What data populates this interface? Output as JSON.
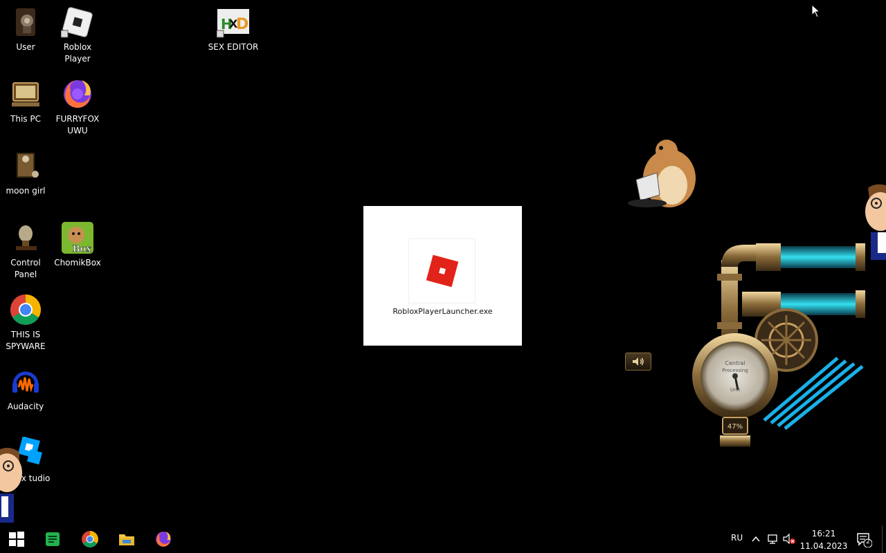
{
  "desktop": {
    "icons": [
      {
        "label": "User",
        "icon": "user-folder-icon"
      },
      {
        "label": "Roblox Player",
        "icon": "roblox-player-icon"
      },
      {
        "label": "SEX EDITOR",
        "icon": "xd-editor-icon"
      },
      {
        "label": "This PC",
        "icon": "this-pc-icon"
      },
      {
        "label": "FURRYFOX UWU",
        "icon": "firefox-icon"
      },
      {
        "label": "moon girl",
        "icon": "folder-icon"
      },
      {
        "label": "Control Panel",
        "icon": "control-panel-icon"
      },
      {
        "label": "ChomikBox",
        "icon": "chomikbox-icon"
      },
      {
        "label": "THIS IS SPYWARE",
        "icon": "chrome-icon"
      },
      {
        "label": "Audacity",
        "icon": "audacity-icon"
      },
      {
        "label": "oblox tudio",
        "icon": "roblox-studio-icon"
      }
    ]
  },
  "launcher": {
    "filename": "RobloxPlayerLauncher.exe",
    "brand_color": "#e2231a"
  },
  "gadget": {
    "meter_percent": "47%",
    "dial_text_1": "Central",
    "dial_text_2": "Processing",
    "dial_text_3": "Unit"
  },
  "taskbar": {
    "apps": [
      "start-icon",
      "notes-app-icon",
      "chrome-icon",
      "file-explorer-icon",
      "firefox-icon"
    ],
    "language": "RU",
    "time": "16:21",
    "date": "11.04.2023",
    "notification_count": "2"
  }
}
